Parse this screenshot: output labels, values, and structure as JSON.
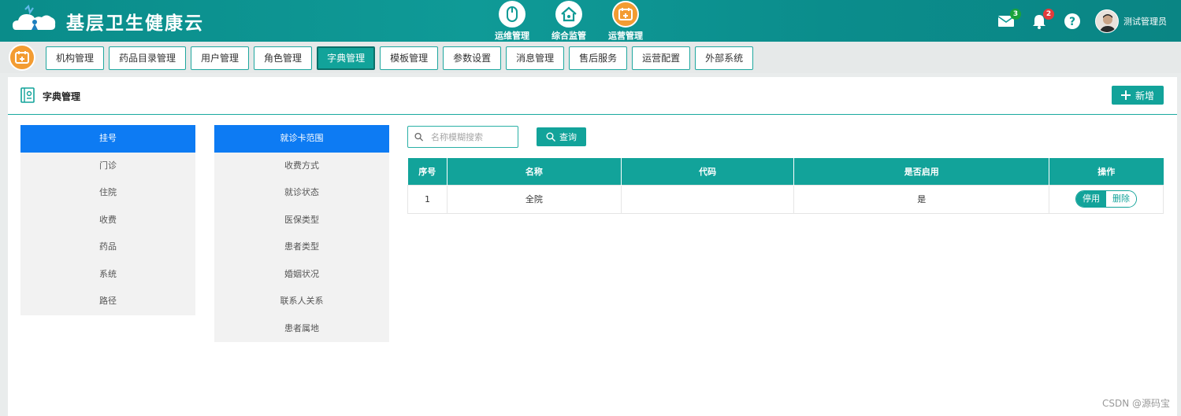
{
  "header": {
    "brand": "基层卫生健康云",
    "nav": [
      {
        "label": "运维管理",
        "icon": "mouse-icon"
      },
      {
        "label": "综合监管",
        "icon": "house-icon"
      },
      {
        "label": "运营管理",
        "icon": "calendar-icon"
      }
    ],
    "mail_badge": "3",
    "bell_badge": "2",
    "username": "测试管理员"
  },
  "tabs": [
    "机构管理",
    "药品目录管理",
    "用户管理",
    "角色管理",
    "字典管理",
    "模板管理",
    "参数设置",
    "消息管理",
    "售后服务",
    "运营配置",
    "外部系统"
  ],
  "active_tab": "字典管理",
  "panel": {
    "title": "字典管理",
    "add_label": "新增"
  },
  "category_list": {
    "items": [
      "挂号",
      "门诊",
      "住院",
      "收费",
      "药品",
      "系统",
      "路径"
    ],
    "active": "挂号"
  },
  "subcategory_list": {
    "items": [
      "就诊卡范围",
      "收费方式",
      "就诊状态",
      "医保类型",
      "患者类型",
      "婚姻状况",
      "联系人关系",
      "患者属地"
    ],
    "active": "就诊卡范围"
  },
  "search": {
    "placeholder": "名称模糊搜索",
    "value": "",
    "query_label": "查询"
  },
  "table": {
    "columns": [
      "序号",
      "名称",
      "代码",
      "是否启用",
      "操作"
    ],
    "rows": [
      {
        "index": "1",
        "name": "全院",
        "code": "",
        "enabled": "是",
        "actions": [
          "停用",
          "删除"
        ]
      }
    ]
  },
  "watermark": "CSDN @源码宝",
  "colors": {
    "primary": "#12a39a",
    "active_blue": "#0d7bf3",
    "orange": "#f39c32"
  }
}
